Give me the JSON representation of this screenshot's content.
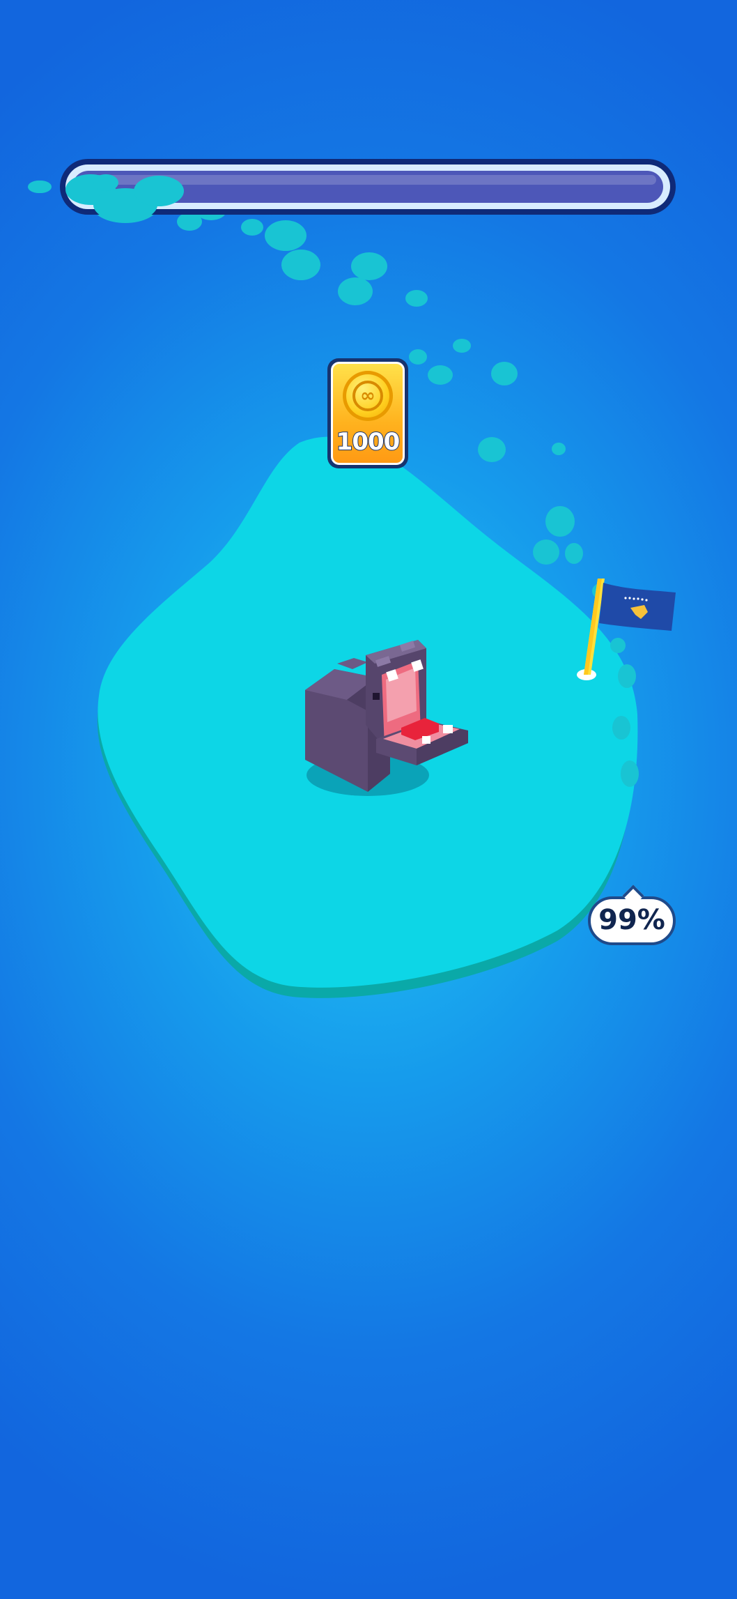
{
  "level_progress": {
    "fraction": 0.0
  },
  "reward": {
    "icon": "coin-icon",
    "amount": "1000"
  },
  "island": {
    "fill_percent": "99%"
  },
  "flag": {
    "icon": "flag-icon"
  },
  "hippo": {
    "icon": "hippo-character"
  },
  "colors": {
    "ocean": "#1676e4",
    "island": "#0dd6e6",
    "island_edge": "#0aa9a8",
    "trail": "#19c4d3",
    "progress_track": "#4d57b8",
    "progress_border": "#0f2a78",
    "coin": "#ffc61e",
    "flag": "#1f4aa8",
    "flag_pole": "#ffe13c",
    "hippo": "#5c4a72"
  }
}
